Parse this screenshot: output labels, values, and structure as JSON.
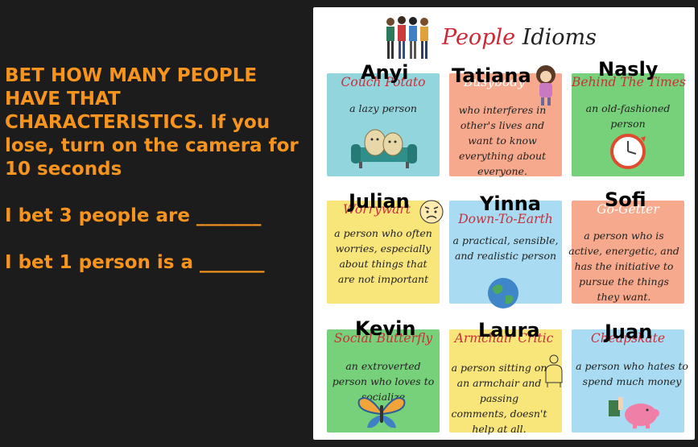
{
  "challenge": {
    "line1": "BET HOW MANY PEOPLE",
    "line2": "HAVE THAT",
    "line3": "CHARACTERISTICS. If you",
    "line4": "lose, turn on the camera for",
    "line5": "10 seconds",
    "bet1": "I bet 3 people are _______",
    "bet2": "I bet 1 person is a _______"
  },
  "poster": {
    "title_word1": "People",
    "title_word2": "Idioms",
    "cards": [
      {
        "idiom": "Couch Potato",
        "definition": "a lazy person",
        "name": "Anyi",
        "bg": "#93d5dc",
        "idiom_color": "#c9303a",
        "icon": "couch-potato-icon"
      },
      {
        "idiom": "Busybody",
        "definition": "who interferes in other's lives and want to know everything about everyone.",
        "name": "Tatiana",
        "bg": "#f6a98c",
        "idiom_color": "#ffffff",
        "icon": "busybody-woman-icon"
      },
      {
        "idiom": "Behind The Times",
        "definition": "an old-fashioned person",
        "name": "Nasly",
        "bg": "#77d17a",
        "idiom_color": "#c9303a",
        "icon": "clock-icon"
      },
      {
        "idiom": "Worrywart",
        "definition": "a person who often worries, especially about things that are not important",
        "name": "Julian",
        "bg": "#f8e67a",
        "idiom_color": "#c9303a",
        "icon": "worried-face-icon"
      },
      {
        "idiom": "Down-To-Earth",
        "definition": "a practical, sensible, and realistic person",
        "name": "Yinna",
        "bg": "#a9dcf2",
        "idiom_color": "#c9303a",
        "icon": "globe-icon"
      },
      {
        "idiom": "Go-Getter",
        "definition": "a person who is active, energetic, and has the initiative to pursue the things they want.",
        "name": "Sofi",
        "bg": "#f6a98c",
        "idiom_color": "#ffffff",
        "icon": "none"
      },
      {
        "idiom": "Social Butterfly",
        "definition": "an extroverted person who loves to socialize",
        "name": "Kevin",
        "bg": "#77d17a",
        "idiom_color": "#c9303a",
        "icon": "butterfly-icon"
      },
      {
        "idiom": "Armchair Critic",
        "definition": "a person sitting on an armchair and passing comments, doesn't help at all.",
        "name": "Laura",
        "bg": "#f8e67a",
        "idiom_color": "#c9303a",
        "icon": "armchair-person-icon"
      },
      {
        "idiom": "Cheapskate",
        "definition": "a person who hates to spend much money",
        "name": "Juan",
        "bg": "#a9dcf2",
        "idiom_color": "#c9303a",
        "icon": "piggy-bank-icon"
      }
    ]
  }
}
